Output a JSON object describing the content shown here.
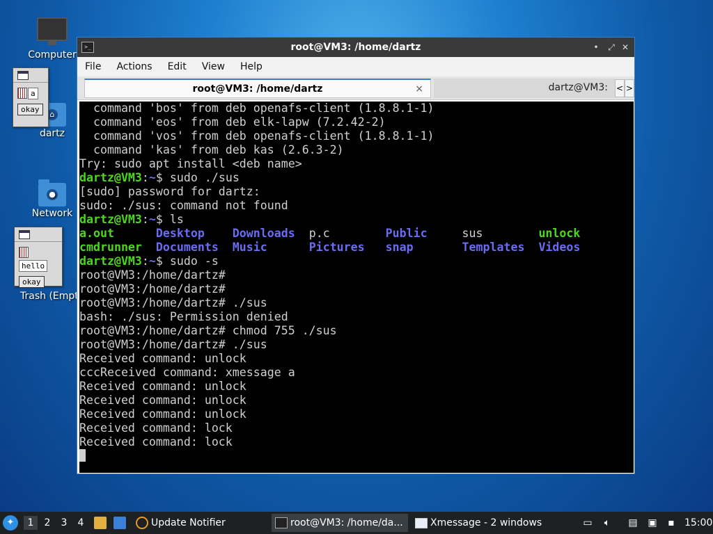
{
  "desktop": {
    "icons": [
      {
        "label": "Computer",
        "icon": "computer-icon"
      },
      {
        "label": "dartz",
        "icon": "home-folder-icon"
      },
      {
        "label": "Network",
        "icon": "network-icon"
      },
      {
        "label": "Trash (Empt",
        "icon": "trash-icon"
      }
    ]
  },
  "xmessages": [
    {
      "text": "a",
      "button": "okay"
    },
    {
      "text": "hello",
      "button": "okay"
    }
  ],
  "terminal": {
    "title": "root@VM3: /home/dartz",
    "menu": [
      "File",
      "Actions",
      "Edit",
      "View",
      "Help"
    ],
    "tabs": [
      {
        "label": "root@VM3: /home/dartz",
        "close": "×"
      },
      {
        "label": "dartz@VM3:"
      }
    ],
    "tab_nav": {
      "left": "<",
      "right": ">"
    },
    "window_buttons": {
      "minimize": "•",
      "maximize": "⤢",
      "close": "✕"
    },
    "lines": [
      "  command 'bos' from deb openafs-client (1.8.8.1-1)",
      "  command 'eos' from deb elk-lapw (7.2.42-2)",
      "  command 'vos' from deb openafs-client (1.8.8.1-1)",
      "  command 'kas' from deb kas (2.6.3-2)",
      "Try: sudo apt install <deb name>",
      {
        "prompt": "dartz@VM3",
        "path": "~",
        "cmd": "$ sudo ./sus"
      },
      "[sudo] password for dartz:",
      "sudo: ./sus: command not found",
      {
        "prompt": "dartz@VM3",
        "path": "~",
        "cmd": "$ ls"
      },
      {
        "ls": [
          [
            "a.out",
            "g"
          ],
          [
            "Desktop",
            "b"
          ],
          [
            "Downloads",
            "b"
          ],
          [
            "p.c",
            ""
          ],
          [
            "Public",
            "b"
          ],
          [
            "sus",
            ""
          ],
          [
            "unlock",
            "g"
          ]
        ]
      },
      {
        "ls": [
          [
            "cmdrunner",
            "g"
          ],
          [
            "Documents",
            "b"
          ],
          [
            "Music",
            "b"
          ],
          [
            "Pictures",
            "b"
          ],
          [
            "snap",
            "b"
          ],
          [
            "Templates",
            "b"
          ],
          [
            "Videos",
            "b"
          ]
        ]
      },
      {
        "prompt": "dartz@VM3",
        "path": "~",
        "cmd": "$ sudo -s"
      },
      "root@VM3:/home/dartz#",
      "root@VM3:/home/dartz#",
      "root@VM3:/home/dartz# ./sus",
      "bash: ./sus: Permission denied",
      "root@VM3:/home/dartz# chmod 755 ./sus",
      "root@VM3:/home/dartz# ./sus",
      "Received command: unlock",
      "cccReceived command: xmessage a",
      "Received command: unlock",
      "Received command: unlock",
      "Received command: unlock",
      "Received command: lock",
      "Received command: lock"
    ]
  },
  "taskbar": {
    "workspaces": [
      "1",
      "2",
      "3",
      "4"
    ],
    "active_workspace": "1",
    "tasks": [
      {
        "label": "Update Notifier",
        "icon": "update-notifier-icon"
      },
      {
        "label": "root@VM3: /home/da...",
        "icon": "terminal-icon"
      },
      {
        "label": "Xmessage - 2 windows",
        "icon": "window-icon"
      }
    ],
    "clock": "15:00"
  }
}
